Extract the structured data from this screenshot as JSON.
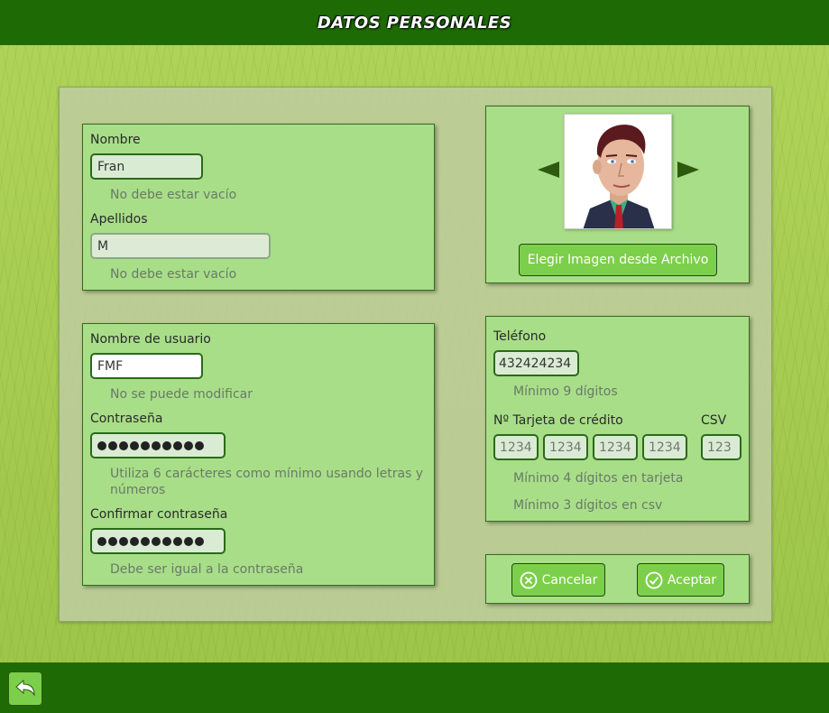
{
  "header": {
    "title": "DATOS PERSONALES"
  },
  "name_panel": {
    "nombre_label": "Nombre",
    "nombre_value": "Fran",
    "nombre_hint": "No debe estar vacío",
    "apellidos_label": "Apellidos",
    "apellidos_value": "M",
    "apellidos_hint": "No debe estar vacío"
  },
  "account_panel": {
    "usuario_label": "Nombre de usuario",
    "usuario_value": "FMF",
    "usuario_hint": "No se puede modificar",
    "password_label": "Contraseña",
    "password_hint": "Utiliza 6 carácteres como mínimo usando letras y números",
    "confirm_label": "Confirmar contraseña",
    "confirm_hint": "Debe ser igual a la contraseña",
    "password_length": 10
  },
  "image_panel": {
    "choose_button": "Elegir Imagen desde Archivo"
  },
  "contact_panel": {
    "telefono_label": "Teléfono",
    "telefono_value": "432424234",
    "telefono_hint": "Mínimo 9 dígitos",
    "tarjeta_label": "Nº Tarjeta de crédito",
    "csv_label": "CSV",
    "card_placeholders": [
      "1234",
      "1234",
      "1234",
      "1234"
    ],
    "csv_placeholder": "123",
    "tarjeta_hint": "Mínimo 4 dígitos en tarjeta",
    "csv_hint": "Mínimo 3 dígitos en csv"
  },
  "actions": {
    "cancel_label": "Cancelar",
    "accept_label": "Aceptar"
  },
  "colors": {
    "bar": "#1e6b05",
    "panel": "#a8de88",
    "button": "#7ccf4a"
  },
  "icons": {
    "back": "back-arrow-icon",
    "prev": "triangle-left-icon",
    "next": "triangle-right-icon",
    "cancel": "circle-x-icon",
    "accept": "circle-check-icon"
  }
}
